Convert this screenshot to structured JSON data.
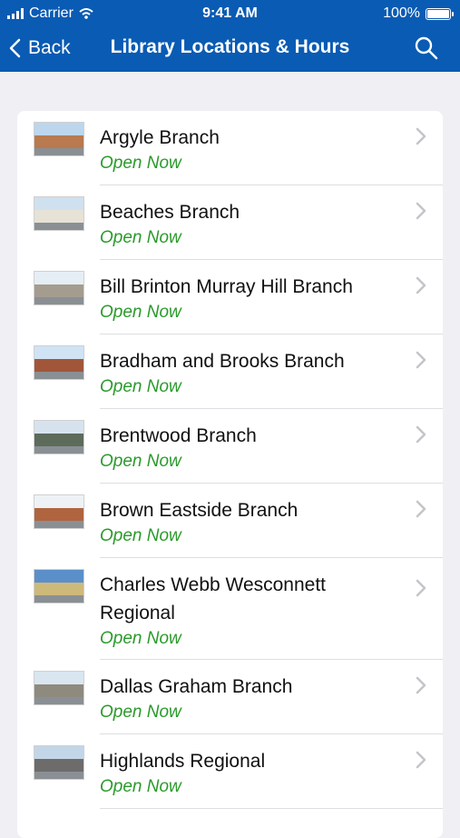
{
  "status_bar": {
    "carrier": "Carrier",
    "time": "9:41 AM",
    "battery": "100%"
  },
  "nav": {
    "back_label": "Back",
    "title": "Library Locations & Hours"
  },
  "colors": {
    "accent": "#0a5bb3",
    "open_status": "#2a9a2a"
  },
  "locations": [
    {
      "name": "Argyle Branch",
      "status": "Open Now"
    },
    {
      "name": "Beaches Branch",
      "status": "Open Now"
    },
    {
      "name": "Bill Brinton Murray Hill Branch",
      "status": "Open Now"
    },
    {
      "name": "Bradham and Brooks Branch",
      "status": "Open Now"
    },
    {
      "name": "Brentwood Branch",
      "status": "Open Now"
    },
    {
      "name": "Brown Eastside Branch",
      "status": "Open Now"
    },
    {
      "name": "Charles Webb Wesconnett Regional",
      "status": "Open Now"
    },
    {
      "name": "Dallas Graham Branch",
      "status": "Open Now"
    },
    {
      "name": "Highlands Regional",
      "status": "Open Now"
    }
  ]
}
